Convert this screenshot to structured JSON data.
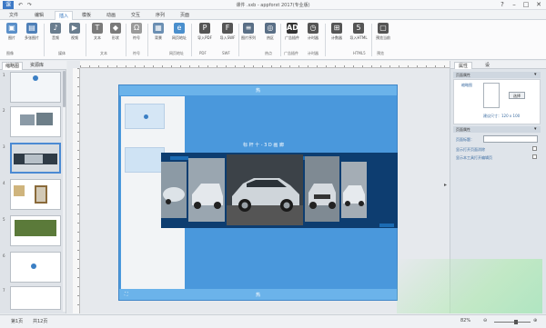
{
  "app": {
    "title": "课件 .sxb - appforxt 2017(专业版)",
    "logo": "课",
    "quick_access": [
      "↶",
      "↷"
    ],
    "window_controls": [
      "?",
      "–",
      "□",
      "✕"
    ]
  },
  "tabs": [
    "文件",
    "编辑",
    "插入",
    "模板",
    "动画",
    "交互",
    "序列",
    "页面"
  ],
  "active_tab": "插入",
  "ribbon": {
    "buttons": [
      {
        "label": "图片",
        "icon": "image-icon",
        "color": "#5a8fc9"
      },
      {
        "label": "多张图片",
        "icon": "images-icon",
        "color": "#4f80b8"
      },
      {
        "label": "音频",
        "icon": "audio-icon",
        "color": "#6a7d8e"
      },
      {
        "label": "视频",
        "icon": "video-icon",
        "color": "#6a7d8e"
      },
      {
        "label": "文本",
        "icon": "text-icon",
        "color": "#7a7a7a"
      },
      {
        "label": "形状",
        "icon": "shape-icon",
        "color": "#7a7a7a"
      },
      {
        "label": "符号",
        "icon": "symbol-icon",
        "color": "#9a9a9a"
      },
      {
        "label": "背景",
        "icon": "background-icon",
        "color": "#6b8fb3"
      },
      {
        "label": "网页地址",
        "icon": "webpage-icon",
        "color": "#4a8fcd"
      },
      {
        "label": "导入PDF",
        "icon": "pdf-icon",
        "color": "#555555"
      },
      {
        "label": "导入SWF",
        "icon": "swf-icon",
        "color": "#555555"
      },
      {
        "label": "图片序列",
        "icon": "sequence-icon",
        "color": "#5a6f86"
      },
      {
        "label": "热区",
        "icon": "hotspot-icon",
        "color": "#5a6f86"
      },
      {
        "label": "广告插件",
        "icon": "ad-icon",
        "color": "#333333"
      },
      {
        "label": "计时器",
        "icon": "timer-icon",
        "color": "#555555"
      },
      {
        "label": "计数器",
        "icon": "counter-icon",
        "color": "#555555"
      },
      {
        "label": "导入HTML",
        "icon": "html-icon",
        "color": "#555555"
      },
      {
        "label": "预览当前",
        "icon": "preview-icon",
        "color": "#555555"
      }
    ],
    "groups": [
      "图像",
      "媒体",
      "文本",
      "符号",
      "网页地址",
      "PDF",
      "SWF",
      "热点",
      "广告插件",
      "计时器",
      "HTML5",
      "预览"
    ]
  },
  "left_panel": {
    "tabs": [
      "缩略图",
      "资源库"
    ],
    "slide_numbers": [
      "1",
      "2",
      "3",
      "4",
      "5",
      "6",
      "7"
    ]
  },
  "slide": {
    "title": "标  杆  十  -  3 D  画  廊",
    "markers": [
      "热",
      "热"
    ]
  },
  "right_panel": {
    "tabs": [
      "属性",
      "设"
    ],
    "section1": "页面属性",
    "thumbnail_label": "缩略图",
    "select_button": "选择",
    "size_hint": "建议尺寸：120 x 100",
    "section2": "页面属性",
    "page_title_label": "页面标题：",
    "page_title_value": "",
    "option1": "显示打开页面消除",
    "option2": "显示本工具打开编辑页"
  },
  "status": {
    "page_info": "第1页",
    "total": "共12页",
    "zoom": "82%",
    "zoom_level": 0.62
  },
  "colors": {
    "stage_blue": "#4a98dc",
    "band_navy": "#0d3d70",
    "accent": "#2a6ebb"
  }
}
